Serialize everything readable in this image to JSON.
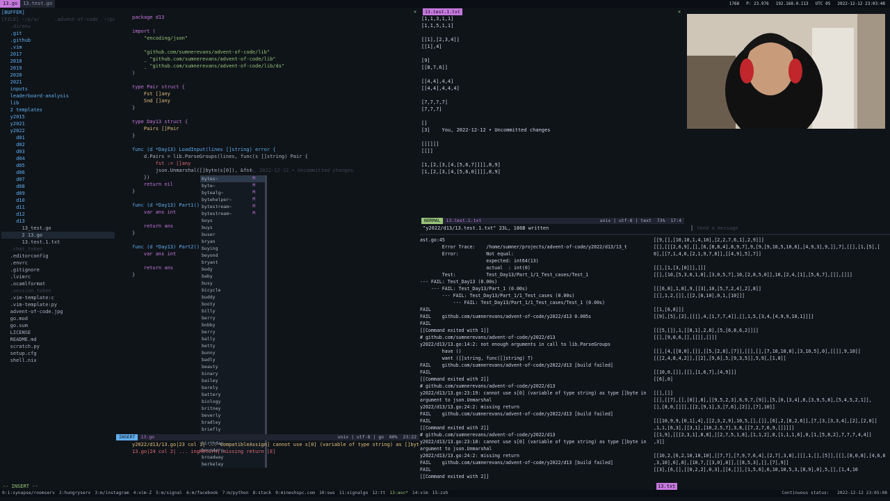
{
  "topbar": {
    "tabs": [
      {
        "label": "13.go",
        "active": true
      },
      {
        "label": "13.test.go",
        "active": false
      }
    ],
    "right": [
      "1768",
      "P: 23.976",
      "192.168.0.113",
      "UTC 05",
      "2022-12-12 23:03:48"
    ]
  },
  "tree": {
    "items": [
      {
        "t": "[BUFFER]",
        "c": "dir"
      },
      {
        "t": "[FILE] ~/p/a/     .advent-of-code  ~/proje",
        "c": "dim"
      },
      {
        "t": "   .direnv",
        "c": "dim"
      },
      {
        "t": "   .git",
        "c": "dir"
      },
      {
        "t": "   .github",
        "c": "dir"
      },
      {
        "t": "   .vim",
        "c": "dir"
      },
      {
        "t": "   2017",
        "c": "dir"
      },
      {
        "t": "   2018",
        "c": "dir"
      },
      {
        "t": "   2019",
        "c": "dir"
      },
      {
        "t": "   2020",
        "c": "dir"
      },
      {
        "t": "   2021",
        "c": "dir"
      },
      {
        "t": "   inputs",
        "c": "dir"
      },
      {
        "t": "   leaderboard-analysis",
        "c": "dir"
      },
      {
        "t": "   lib",
        "c": "dir"
      },
      {
        "t": "   2 templates",
        "c": "dir"
      },
      {
        "t": "   y2015",
        "c": "dir"
      },
      {
        "t": "   y2021",
        "c": "dir"
      },
      {
        "t": "   y2022",
        "c": "dir"
      },
      {
        "t": "     d01",
        "c": "dir"
      },
      {
        "t": "     d02",
        "c": "dir"
      },
      {
        "t": "     d03",
        "c": "dir"
      },
      {
        "t": "     d04",
        "c": "dir"
      },
      {
        "t": "     d05",
        "c": "dir"
      },
      {
        "t": "     d06",
        "c": "dir"
      },
      {
        "t": "     d07",
        "c": "dir"
      },
      {
        "t": "     d08",
        "c": "dir"
      },
      {
        "t": "     d09",
        "c": "dir"
      },
      {
        "t": "     d10",
        "c": "dir"
      },
      {
        "t": "     d11",
        "c": "dir"
      },
      {
        "t": "     d12",
        "c": "dir"
      },
      {
        "t": "     d13",
        "c": "dir"
      },
      {
        "t": "       13_test.go",
        "c": "file"
      },
      {
        "t": "       2 13.go",
        "c": "file"
      },
      {
        "t": "       13.test.1.txt",
        "c": "file"
      },
      {
        "t": "   .chat_token",
        "c": "dim"
      },
      {
        "t": "   .editorconfig",
        "c": "file"
      },
      {
        "t": "   .envrc",
        "c": "file"
      },
      {
        "t": "   .gitignore",
        "c": "file"
      },
      {
        "t": "   .lvimrc",
        "c": "file"
      },
      {
        "t": "   .ocamlformat",
        "c": "file"
      },
      {
        "t": "   .session_token",
        "c": "dim"
      },
      {
        "t": "   .vim-template:c",
        "c": "file"
      },
      {
        "t": "   .vim-template:py",
        "c": "file"
      },
      {
        "t": "   advent-of-code.jpg",
        "c": "file"
      },
      {
        "t": "   go.mod",
        "c": "file"
      },
      {
        "t": "   go.sum",
        "c": "file"
      },
      {
        "t": "   LICENSE",
        "c": "file"
      },
      {
        "t": "   README.md",
        "c": "file"
      },
      {
        "t": "   scratch.py",
        "c": "file"
      },
      {
        "t": "   setup.cfg",
        "c": "file"
      },
      {
        "t": "   shell.nix",
        "c": "file"
      }
    ]
  },
  "editor": {
    "lines": [
      {
        "t": "package d13",
        "c": "kw"
      },
      {
        "t": "",
        "c": ""
      },
      {
        "t": "import (",
        "c": "kw"
      },
      {
        "t": "    \"encoding/json\"",
        "c": "str"
      },
      {
        "t": "",
        "c": ""
      },
      {
        "t": "    \"github.com/sumnerevans/advent-of-code/lib\"",
        "c": "str"
      },
      {
        "t": "    _ \"github.com/sumnerevans/advent-of-code/lib\"",
        "c": "str"
      },
      {
        "t": "    _ \"github.com/sumnerevans/advent-of-code/lib/ds\"",
        "c": "str"
      },
      {
        "t": ")",
        "c": ""
      },
      {
        "t": "",
        "c": ""
      },
      {
        "t": "type Pair struct {",
        "c": "kw"
      },
      {
        "t": "    Fst []any",
        "c": "ty"
      },
      {
        "t": "    Snd []any",
        "c": "ty"
      },
      {
        "t": "}",
        "c": ""
      },
      {
        "t": "",
        "c": ""
      },
      {
        "t": "type Day13 struct {",
        "c": "kw"
      },
      {
        "t": "    Pairs []Pair",
        "c": "ty"
      },
      {
        "t": "}",
        "c": ""
      },
      {
        "t": "",
        "c": ""
      },
      {
        "t": "func (d *Day13) LoadInput(lines []string) error {",
        "c": "fn"
      },
      {
        "t": "    d.Pairs = lib.ParseGroups(lines, func(s []string) Pair {",
        "c": ""
      },
      {
        "t": "        fst := []any",
        "c": "red"
      },
      {
        "t": "        json.Unmarshal([]byte(s[0]), &fst",
        "c": ""
      },
      {
        "t": "    })",
        "c": ""
      },
      {
        "t": "    return nil",
        "c": "kw"
      },
      {
        "t": "}",
        "c": ""
      },
      {
        "t": "",
        "c": ""
      },
      {
        "t": "func (d *Day13) Part1() int {",
        "c": "fn"
      },
      {
        "t": "    var ans int",
        "c": "kw"
      },
      {
        "t": "",
        "c": ""
      },
      {
        "t": "    return ans",
        "c": "kw"
      },
      {
        "t": "}",
        "c": ""
      },
      {
        "t": "",
        "c": ""
      },
      {
        "t": "func (d *Day13) Part2() int {",
        "c": "fn"
      },
      {
        "t": "    var ans int",
        "c": "kw"
      },
      {
        "t": "",
        "c": ""
      },
      {
        "t": "    return ans",
        "c": "kw"
      },
      {
        "t": "}",
        "c": ""
      }
    ],
    "blame": "You, 2022-12-12 • Uncommitted changes",
    "status": {
      "mode": "INSERT",
      "file": "13.go",
      "right": "unix | utf-8 | go  60%  23:22"
    },
    "diagnostics": [
      "y2022/d13/13.go|23 col 1| ... compatibleAssign] cannot use s[0] (variable of type string) as []byte value in argument to json.Unmarshal [E]",
      "13.go|24 col 2| ... ingReturn] missing return [E]"
    ]
  },
  "popup": {
    "items": [
      {
        "label": "bytes~",
        "kind": "M"
      },
      {
        "label": "byte~",
        "kind": "M"
      },
      {
        "label": "bytealg~",
        "kind": "M"
      },
      {
        "label": "bytehelper~",
        "kind": "M"
      },
      {
        "label": "bytestream~",
        "kind": "M"
      },
      {
        "label": "bytestream~",
        "kind": "M"
      },
      {
        "label": "boys",
        "kind": ""
      },
      {
        "label": "buys",
        "kind": ""
      },
      {
        "label": "buser",
        "kind": ""
      },
      {
        "label": "bryan",
        "kind": ""
      },
      {
        "label": "buying",
        "kind": ""
      },
      {
        "label": "beyond",
        "kind": ""
      },
      {
        "label": "bryant",
        "kind": ""
      },
      {
        "label": "body",
        "kind": ""
      },
      {
        "label": "baby",
        "kind": ""
      },
      {
        "label": "busy",
        "kind": ""
      },
      {
        "label": "bicycle",
        "kind": ""
      },
      {
        "label": "buddy",
        "kind": ""
      },
      {
        "label": "booty",
        "kind": ""
      },
      {
        "label": "billy",
        "kind": ""
      },
      {
        "label": "berry",
        "kind": ""
      },
      {
        "label": "bobby",
        "kind": ""
      },
      {
        "label": "berry",
        "kind": ""
      },
      {
        "label": "bally",
        "kind": ""
      },
      {
        "label": "betty",
        "kind": ""
      },
      {
        "label": "bunny",
        "kind": ""
      },
      {
        "label": "badly",
        "kind": ""
      },
      {
        "label": "beauty",
        "kind": ""
      },
      {
        "label": "binary",
        "kind": ""
      },
      {
        "label": "bailey",
        "kind": ""
      },
      {
        "label": "barely",
        "kind": ""
      },
      {
        "label": "battery",
        "kind": ""
      },
      {
        "label": "biology",
        "kind": ""
      },
      {
        "label": "britney",
        "kind": ""
      },
      {
        "label": "beverly",
        "kind": ""
      },
      {
        "label": "bradley",
        "kind": ""
      },
      {
        "label": "briefly",
        "kind": ""
      },
      {
        "label": "brooklyn",
        "kind": ""
      },
      {
        "label": "birthday",
        "kind": ""
      },
      {
        "label": "boundary",
        "kind": ""
      },
      {
        "label": "broadway",
        "kind": ""
      },
      {
        "label": "berkeley",
        "kind": ""
      }
    ]
  },
  "txt": {
    "title": "13.test.1.txt",
    "lines": [
      "[1,1,3,1,1]",
      "[1,1,5,1,1]",
      "",
      "[[1],[2,3,4]]",
      "[[1],4]",
      "",
      "[9]",
      "[[8,7,6]]",
      "",
      "[[4,4],4,4]",
      "[[4,4],4,4,4]",
      "",
      "[7,7,7,7]",
      "[7,7,7]",
      "",
      "[]",
      "[3]    You, 2022-12-12 • Uncommitted changes",
      "",
      "[[[]]]",
      "[[]]",
      "",
      "[1,[2,[3,[4,[5,6,7]]]],8,9]",
      "[1,[2,[3,[4,[5,6,0]]]],8,9]"
    ],
    "status": {
      "mode": "NORMAL",
      "file": "13.test.1.txt",
      "right": "unix | utf-8 | text  73%  17:4"
    },
    "written": "\"y2022/d13/13.test.1.txt\" 23L, 186B written"
  },
  "termleft": {
    "lines": [
      "ast.go:45",
      "        Error Trace:    /home/sumner/projects/advent-of-code/y2022/d13/13_t",
      "        Error:          Not equal:",
      "                        expected: int64(13)",
      "                        actual  : int(0)",
      "        Test:           Test_Day13/Part_1/1_Test_cases/Test_1",
      "--- FAIL: Test_Day13 (0.00s)",
      "    --- FAIL: Test_Day13/Part_1 (0.00s)",
      "        --- FAIL: Test_Day13/Part_1/1_Test_cases (0.00s)",
      "            --- FAIL: Test_Day13/Part_1/1_Test_cases/Test_1 (0.00s)",
      "FAIL",
      "FAIL    github.com/sumnerevans/advent-of-code/y2022/d13 0.005s",
      "FAIL",
      "[[Command exited with 1]]",
      "# github.com/sumnerevans/advent-of-code/y2022/d13",
      "y2022/d13/13.go:14:2: not enough arguments in call to lib.ParseGroups",
      "        have ()",
      "        want ([]string, func([]string) T)",
      "FAIL    github.com/sumnerevans/advent-of-code/y2022/d13 [build failed]",
      "FAIL",
      "[[Command exited with 2]]",
      "# github.com/sumnerevans/advent-of-code/y2022/d13",
      "y2022/d13/13.go:23:19: cannot use s[0] (variable of type string) as type []byte in",
      "argument to json.Unmarshal",
      "y2022/d13/13.go:24:2: missing return",
      "FAIL    github.com/sumnerevans/advent-of-code/y2022/d13 [build failed]",
      "FAIL",
      "[[Command exited with 2]]",
      "# github.com/sumnerevans/advent-of-code/y2022/d13",
      "y2022/d13/13.go:23:18: cannot use s[0] (variable of type string) as type []byte in",
      "argument to json.Unmarshal",
      "y2022/d13/13.go:24:2: missing return",
      "FAIL    github.com/sumnerevans/advent-of-code/y2022/d13 [build failed]",
      "FAIL",
      "[[Command exited with 2]]"
    ]
  },
  "termright": {
    "lines": [
      "[[9,[],[10,10,1,4,10],[2,2,7,6,1],2,9]]]",
      "[[],[[[2,6,9],[],[6,[8,8,4],8,9,7],9,[9,[9,10,5,10,6],[4,9,3],9,]],7],[[],[1,[5],[",
      "0],[[7,1,4,6,[2,1,9,7,8]],[[4,9],5],7]]",
      "",
      "[[],[1,[3,[0]]],[]]",
      "[[],[10,[5,3,0,1,0],[3,0,5,7],10,[2,8,5,0]],10,[2,4,[1],[5,6,7],[]],[]]]",
      "",
      "[[[6,8],1,8],9,[[3],10,[5,7,2,4],2],8]]",
      "[[],1,2,[]],[[2,[8,10],0,1,[10]]]",
      "",
      "[[1,[6,8]]]",
      "[[9],[5],[2],[[[],4,[1,7,7,4]],[],1,5,[3,4,[4,9,9,10,1]]]]",
      "",
      "[[[5,[]],1,[[8,1],2,8],[5,[6,8,6,2]]]]",
      "[[],[9,0,6,[],[[]],[]]]",
      "",
      "[[],[4,[[8,0],[]],[[5,[2,8],[7]],[[],[],[7,10,10,0],[3,10,5],0],[[]],9,10]]",
      "[[[2,4,8,4,2]],[[2],[9,6],5,[9,3,5]],5,9],[1,8]]",
      "",
      "[[10,0,[]],[[],[1,6,7],[4,9]]]",
      "[[6],0]",
      "",
      "[[],[]]",
      "[[],[[7],[],[0]],8],[[9,5,2,3],6,9,7,[9]],[5,[0,[3,4],8,[3,9,5,8],[5,4,5,2,1]],",
      "[],[8,0,[]]],[[2,[9,1],3,[7,6],[2]],[7],10]]",
      "",
      "[[[10,9,9,[0,1],4],[[2,3,2,9],10,5,[],[]],[6],2,[8,2,6]],[7,[3,[3,3,4],[2],[2,0]]",
      ",1,1,[6,3],[[3,1],[10,2,5,7],3,8,[[7,2,7,6,9,[]]]]]",
      "[[1,9],[[[2,3,1],8,8],[[2,7,5,1,8],[1,1,2],8,[1,1,1,6],0,[1,[5,8,2],7,7,7,4,4]]",
      ",3]]",
      "",
      "[[10,2,[6,2,10,10,10],[[7,7],[7,9,7,6,4],[2,7],3,8],[[],1,[],[5]],[[],[8,0,8],[4,6,6",
      ",3,10],6],8],[10,7,[[3,0],8]],[[8,5,3],[],[7],9]]",
      "[[3],[6,[],[[0,2,2],0,3],[[4,[]],[1,5,6],6,10,10,5,3,[8,9],0],5,[],[1,4,10"
    ],
    "footer": "13.txt"
  },
  "bottombar": {
    "workspaces": [
      "0:1:synapse/roomserv",
      "2:hungryserv",
      "3:m/instagram",
      "4:vim-Z",
      "5:m/signal",
      "6:m/facebook",
      "7:m/python",
      "8:stack",
      "9:mineshspc.com",
      "10:sws",
      "11:signalgo",
      "12:tt",
      "13:aoc*",
      "14:vim",
      "15:zsh"
    ],
    "right": "Continuous status:   2022-12-12 23:05:08"
  },
  "colors": {
    "accent": "#c678dd",
    "insert": "#61afef",
    "normal": "#98c379",
    "error": "#e06c75",
    "background": "#0f1419"
  }
}
